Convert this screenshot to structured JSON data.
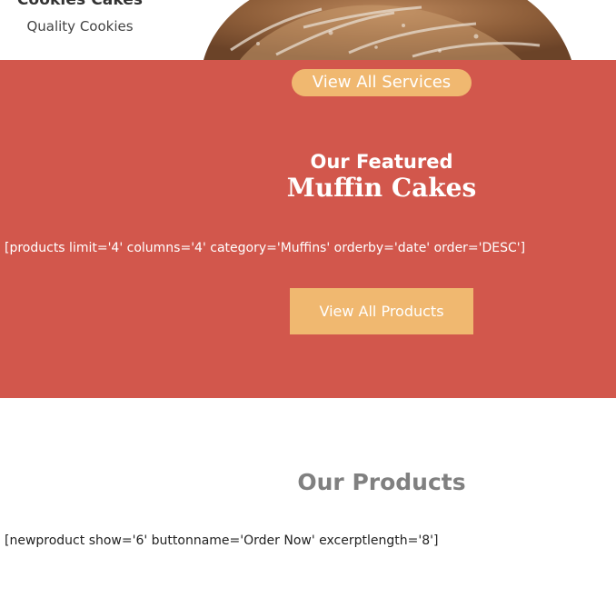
{
  "header": {
    "brand_name": "Cookies Cakes",
    "tagline": "Quality Cookies"
  },
  "featured": {
    "services_button": "View All Services",
    "kicker": "Our Featured",
    "title": "Muffin Cakes",
    "shortcode": "[products limit='4' columns='4' category='Muffins' orderby='date' order='DESC']",
    "products_button": "View All Products"
  },
  "products": {
    "title": "Our Products",
    "shortcode": "[newproduct show='6' buttonname='Order Now' excerptlength='8']"
  },
  "colors": {
    "section_red": "#d2574c",
    "button_orange": "#f0b870",
    "heading_gray": "#808080"
  },
  "icons": {
    "hero": "bread-loaf-image"
  }
}
